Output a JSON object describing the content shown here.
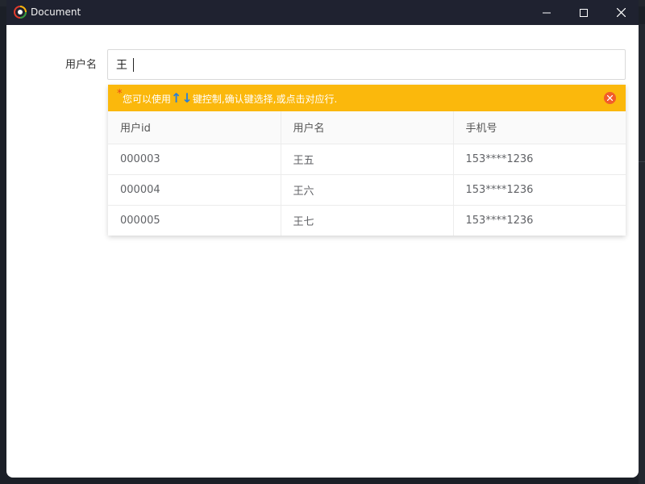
{
  "window": {
    "title": "Document",
    "icon": "app-logo-icon"
  },
  "form": {
    "label": "用户名",
    "value": "王"
  },
  "hint": {
    "prefix": "*",
    "text_before": "您可以使用",
    "arrow_up": "↑",
    "arrow_down": "↓",
    "text_after": "键控制,确认键选择,或点击对应行."
  },
  "table": {
    "columns": [
      "用户id",
      "用户名",
      "手机号"
    ],
    "rows": [
      [
        "000003",
        "王五",
        "153****1236"
      ],
      [
        "000004",
        "王六",
        "153****1236"
      ],
      [
        "000005",
        "王七",
        "153****1236"
      ]
    ]
  },
  "colors": {
    "hint_bg": "#fbb80c",
    "close_btn": "#f25c2a",
    "titlebar": "#1f2230"
  }
}
